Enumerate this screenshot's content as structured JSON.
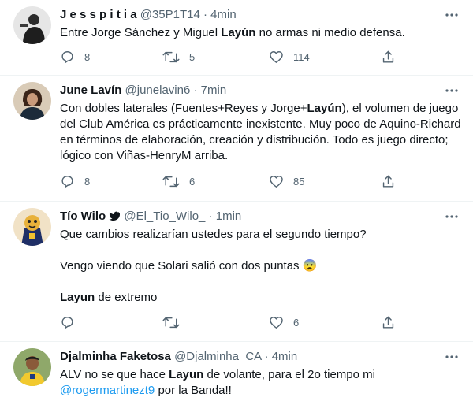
{
  "tweets": [
    {
      "name": "J e s s p i t i a",
      "handle": "@35P1T14",
      "sep": "·",
      "time": "4min",
      "text_before": "Entre Jorge Sánchez y Miguel ",
      "bold": "Layún",
      "text_after": " no armas ni medio defensa.",
      "replies": "8",
      "retweets": "5",
      "likes": "114"
    },
    {
      "name": "June Lavín",
      "handle": "@junelavin6",
      "sep": "·",
      "time": "7min",
      "text_before": "Con dobles laterales (Fuentes+Reyes y Jorge+",
      "bold": "Layún",
      "text_after": "), el volumen de juego del Club América es prácticamente inexistente. Muy poco de Aquino-Richard en términos de elaboración, creación y distribución. Todo es juego directo; lógico con Viñas-HenryM arriba.",
      "replies": "8",
      "retweets": "6",
      "likes": "85"
    },
    {
      "name": "Tío Wilo",
      "handle": "@El_Tio_Wilo_",
      "sep": "·",
      "time": "1min",
      "line1": "Que cambios realizarían ustedes para el segundo tiempo?",
      "line2": "Vengo viendo que Solari salió con dos puntas 😨",
      "line3_bold": "Layun",
      "line3_rest": " de extremo",
      "replies": "",
      "retweets": "",
      "likes": "6"
    },
    {
      "name": "Djalminha Faketosa",
      "handle": "@Djalminha_CA",
      "sep": "·",
      "time": "4min",
      "text_before": "ALV no se que hace ",
      "bold": "Layun",
      "text_after": " de volante, para el 2o tiempo mi",
      "mention": "@rogermartinezt9",
      "text_end": " por la Banda!!"
    }
  ],
  "colors": {
    "text": "#0f1419",
    "secondary": "#536471",
    "link": "#1d9bf0",
    "border": "#eff3f4"
  },
  "icons": [
    "more-icon",
    "reply-icon",
    "retweet-icon",
    "like-icon",
    "share-icon",
    "bird-icon"
  ]
}
